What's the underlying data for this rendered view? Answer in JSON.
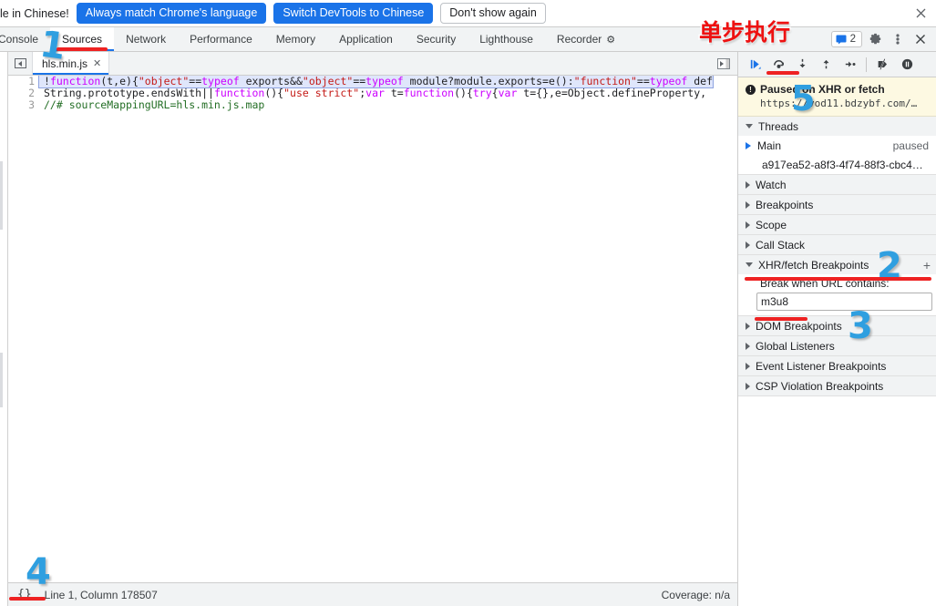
{
  "banner": {
    "text": "le in Chinese!",
    "buttons": [
      {
        "label": "Always match Chrome's language",
        "style": "primary"
      },
      {
        "label": "Switch DevTools to Chinese",
        "style": "primary"
      },
      {
        "label": "Don't show again",
        "style": "secondary"
      }
    ],
    "close_icon": "close-icon"
  },
  "tabbar": {
    "tabs": [
      {
        "label": "Console",
        "selected": false
      },
      {
        "label": "Sources",
        "selected": true
      },
      {
        "label": "Network",
        "selected": false
      },
      {
        "label": "Performance",
        "selected": false
      },
      {
        "label": "Memory",
        "selected": false
      },
      {
        "label": "Application",
        "selected": false
      },
      {
        "label": "Security",
        "selected": false
      },
      {
        "label": "Lighthouse",
        "selected": false
      },
      {
        "label": "Recorder",
        "selected": false,
        "icon": "flask-icon"
      }
    ],
    "messages_count": "2",
    "settings_icon": "gear-icon",
    "more_icon": "kebab-menu-icon",
    "close_icon": "close-icon"
  },
  "editor": {
    "file_tab": {
      "label": "hls.min.js",
      "close_icon": "close-icon"
    },
    "navigator_toggle_icon": "show-navigator-icon",
    "panel_toggle_icon": "show-debugger-sidebar-icon",
    "lines": [
      {
        "number": "1",
        "paused": true,
        "tokens": [
          {
            "t": "!",
            "c": "punc"
          },
          {
            "t": "function",
            "c": "kw"
          },
          {
            "t": "(t,e){",
            "c": "punc"
          },
          {
            "t": "\"object\"",
            "c": "str"
          },
          {
            "t": "==",
            "c": "punc"
          },
          {
            "t": "typeof",
            "c": "kw"
          },
          {
            "t": " exports&&",
            "c": "punc"
          },
          {
            "t": "\"object\"",
            "c": "str"
          },
          {
            "t": "==",
            "c": "punc"
          },
          {
            "t": "typeof",
            "c": "kw"
          },
          {
            "t": " module?module.exports=e():",
            "c": "punc"
          },
          {
            "t": "\"function\"",
            "c": "str"
          },
          {
            "t": "==",
            "c": "punc"
          },
          {
            "t": "typeof",
            "c": "kw"
          },
          {
            "t": " def",
            "c": "punc"
          }
        ]
      },
      {
        "number": "2",
        "paused": false,
        "tokens": [
          {
            "t": "String.prototype.endsWith||",
            "c": "punc"
          },
          {
            "t": "function",
            "c": "kw"
          },
          {
            "t": "(){",
            "c": "punc"
          },
          {
            "t": "\"use strict\"",
            "c": "str"
          },
          {
            "t": ";",
            "c": "punc"
          },
          {
            "t": "var",
            "c": "kw"
          },
          {
            "t": " t=",
            "c": "punc"
          },
          {
            "t": "function",
            "c": "kw"
          },
          {
            "t": "(){",
            "c": "punc"
          },
          {
            "t": "try",
            "c": "kw"
          },
          {
            "t": "{",
            "c": "punc"
          },
          {
            "t": "var",
            "c": "kw"
          },
          {
            "t": " t={},e=Object.defineProperty,",
            "c": "punc"
          }
        ]
      },
      {
        "number": "3",
        "paused": false,
        "tokens": [
          {
            "t": "//# sourceMappingURL=hls.min.js.map",
            "c": "com"
          }
        ]
      }
    ]
  },
  "statusbar": {
    "pretty_print_label": "{}",
    "position": "Line 1, Column 178507",
    "coverage": "Coverage: n/a"
  },
  "debugger": {
    "toolbar": [
      {
        "name": "resume-script-execution-button",
        "icon": "resume-icon"
      },
      {
        "name": "step-over-button",
        "icon": "step-over-icon"
      },
      {
        "name": "step-into-button",
        "icon": "step-into-icon"
      },
      {
        "name": "step-out-button",
        "icon": "step-out-icon"
      },
      {
        "name": "step-button",
        "icon": "step-icon"
      },
      {
        "name": "deactivate-breakpoints-button",
        "icon": "deactivate-breakpoints-icon"
      },
      {
        "name": "pause-on-exceptions-button",
        "icon": "pause-on-exceptions-icon"
      }
    ],
    "paused_banner": {
      "icon": "info-icon",
      "title": "Paused on XHR or fetch",
      "url": "https://vod11.bdzybf.com/…"
    },
    "threads": {
      "title": "Threads",
      "expanded": true,
      "rows": [
        {
          "name": "Main",
          "state": "paused",
          "selected": true
        },
        {
          "name": "a917ea52-a8f3-4f74-88f3-cbc4…",
          "state": "",
          "selected": false
        }
      ]
    },
    "sections": [
      {
        "title": "Watch",
        "expanded": false
      },
      {
        "title": "Breakpoints",
        "expanded": false
      },
      {
        "title": "Scope",
        "expanded": false
      },
      {
        "title": "Call Stack",
        "expanded": false
      }
    ],
    "xhr": {
      "title": "XHR/fetch Breakpoints",
      "expanded": true,
      "add_label": "+",
      "label": "Break when URL contains:",
      "value": "m3u8",
      "placeholder": ""
    },
    "sections_after": [
      {
        "title": "DOM Breakpoints",
        "expanded": false
      },
      {
        "title": "Global Listeners",
        "expanded": false
      },
      {
        "title": "Event Listener Breakpoints",
        "expanded": false
      },
      {
        "title": "CSP Violation Breakpoints",
        "expanded": false
      }
    ]
  },
  "annotations": {
    "chinese_label": "单步执行",
    "num1": "1",
    "num2": "2",
    "num3": "3",
    "num4": "4",
    "num5": "5"
  }
}
